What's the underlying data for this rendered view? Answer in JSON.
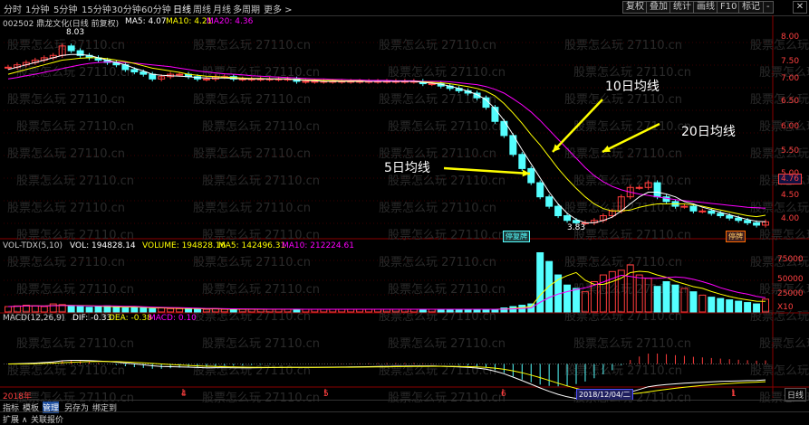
{
  "toolbar": {
    "timeframes": [
      "分时",
      "1分钟",
      "5分钟",
      "15分钟",
      "30分钟",
      "60分钟",
      "日线",
      "周线",
      "月线",
      "多周期",
      "更多 >"
    ],
    "active": "日线",
    "buttons": [
      "复权",
      "叠加",
      "统计",
      "画线",
      "F10",
      "标记",
      "-"
    ],
    "close_label": "✕"
  },
  "price_panel": {
    "title": "002502 鼎龙文化(日线 前复权)",
    "ma5_label": "MA5: 4.07",
    "ma10_label": "MA10: 4.21",
    "ma20_label": "MA20: 4.36",
    "top_value": "8.03",
    "low_value": "3.83",
    "y_ticks": [
      "8.00",
      "7.50",
      "7.00",
      "6.50",
      "6.00",
      "5.50",
      "5.00",
      "4.50",
      "4.00"
    ],
    "current_price": "4.76",
    "badge_left": "停复牌",
    "badge_right": "停牌"
  },
  "annotations": {
    "ma10": "10日均线",
    "ma20": "20日均线",
    "ma5": "5日均线"
  },
  "volume_panel": {
    "title": "VOL-TDX(5,10)",
    "vol_label": "VOL: 194828.14",
    "volume_label": "VOLUME: 194828.16",
    "ma5_label": "MA5: 142496.31",
    "ma10_label": "MA10: 212224.61",
    "y_ticks": [
      "75000",
      "50000",
      "25000"
    ],
    "unit": "X10"
  },
  "macd_panel": {
    "title": "MACD(12,26,9)",
    "dif_label": "DIF: -0.33",
    "dea_label": "DEA: -0.38",
    "macd_label": "MACD: 0.10"
  },
  "xaxis": {
    "year_label": "2018年",
    "month_marks": [
      "4",
      "5",
      "6",
      "1"
    ],
    "cursor_date": "2018/12/04/二",
    "side_label": "日线"
  },
  "bottom_tabs": [
    "指标",
    "模板",
    "管理",
    "另存为",
    "绑定到"
  ],
  "bottom_tabs_active": "管理",
  "status_bar": [
    "扩展 ∧",
    "关联报价"
  ],
  "watermark": "股票怎么玩 27110.cn",
  "colors": {
    "up": "#ff3c3c",
    "down": "#54ffff",
    "ma5": "#ffffff",
    "ma10": "#ffff00",
    "ma20": "#ff00ff",
    "text_red": "#ff4040"
  },
  "chart_data": {
    "type": "candlestick",
    "title": "002502 鼎龙文化(日线 前复权)",
    "ylim": [
      3.75,
      8.2
    ],
    "closes": [
      7.35,
      7.4,
      7.45,
      7.5,
      7.55,
      7.6,
      7.8,
      7.7,
      7.6,
      7.55,
      7.5,
      7.45,
      7.4,
      7.3,
      7.25,
      7.2,
      7.1,
      7.15,
      7.2,
      7.2,
      7.15,
      7.1,
      7.1,
      7.15,
      7.15,
      7.1,
      7.1,
      7.1,
      7.1,
      7.1,
      7.1,
      7.1,
      7.05,
      7.05,
      7.05,
      7.05,
      7.05,
      7.05,
      7.05,
      7.05,
      7.05,
      7.05,
      7.05,
      7.05,
      7.05,
      7.05,
      7.0,
      7.0,
      6.95,
      6.9,
      6.85,
      6.8,
      6.7,
      6.5,
      6.2,
      5.9,
      5.5,
      5.2,
      4.9,
      4.6,
      4.4,
      4.2,
      4.1,
      4.05,
      4.05,
      4.1,
      4.2,
      4.3,
      4.6,
      4.8,
      4.8,
      4.9,
      4.6,
      4.5,
      4.4,
      4.4,
      4.3,
      4.3,
      4.25,
      4.2,
      4.15,
      4.1,
      4.05,
      4.0,
      4.07
    ],
    "ma5": [
      7.3,
      7.35,
      7.4,
      7.45,
      7.5,
      7.55,
      7.6,
      7.62,
      7.62,
      7.6,
      7.55,
      7.5,
      7.45,
      7.4,
      7.33,
      7.27,
      7.2,
      7.18,
      7.17,
      7.16,
      7.15,
      7.13,
      7.12,
      7.12,
      7.12,
      7.11,
      7.1,
      7.1,
      7.1,
      7.1,
      7.1,
      7.1,
      7.08,
      7.07,
      7.06,
      7.05,
      7.05,
      7.05,
      7.05,
      7.05,
      7.05,
      7.05,
      7.05,
      7.05,
      7.05,
      7.05,
      7.03,
      7.01,
      6.99,
      6.95,
      6.9,
      6.84,
      6.77,
      6.66,
      6.47,
      6.22,
      5.92,
      5.6,
      5.3,
      5.0,
      4.7,
      4.45,
      4.25,
      4.12,
      4.05,
      4.05,
      4.1,
      4.17,
      4.3,
      4.45,
      4.6,
      4.7,
      4.7,
      4.66,
      4.6,
      4.5,
      4.45,
      4.38,
      4.33,
      4.27,
      4.22,
      4.17,
      4.12,
      4.08,
      4.07
    ],
    "ma10": [
      7.2,
      7.25,
      7.3,
      7.35,
      7.4,
      7.45,
      7.5,
      7.52,
      7.54,
      7.55,
      7.55,
      7.53,
      7.5,
      7.47,
      7.43,
      7.38,
      7.33,
      7.3,
      7.27,
      7.24,
      7.2,
      7.18,
      7.16,
      7.15,
      7.14,
      7.13,
      7.12,
      7.11,
      7.11,
      7.1,
      7.1,
      7.1,
      7.09,
      7.08,
      7.08,
      7.07,
      7.07,
      7.06,
      7.06,
      7.06,
      7.05,
      7.05,
      7.05,
      7.05,
      7.05,
      7.05,
      7.04,
      7.03,
      7.02,
      7.0,
      6.97,
      6.94,
      6.9,
      6.84,
      6.74,
      6.58,
      6.38,
      6.16,
      5.92,
      5.7,
      5.45,
      5.2,
      4.98,
      4.78,
      4.6,
      4.45,
      4.35,
      4.3,
      4.3,
      4.32,
      4.38,
      4.42,
      4.45,
      4.45,
      4.45,
      4.45,
      4.43,
      4.4,
      4.36,
      4.32,
      4.28,
      4.24,
      4.2,
      4.18,
      4.21
    ],
    "ma20": [
      7.1,
      7.13,
      7.17,
      7.2,
      7.24,
      7.28,
      7.32,
      7.36,
      7.4,
      7.43,
      7.45,
      7.46,
      7.46,
      7.45,
      7.44,
      7.42,
      7.4,
      7.38,
      7.36,
      7.33,
      7.3,
      7.27,
      7.25,
      7.23,
      7.21,
      7.2,
      7.19,
      7.17,
      7.16,
      7.15,
      7.14,
      7.13,
      7.12,
      7.11,
      7.1,
      7.1,
      7.09,
      7.09,
      7.08,
      7.08,
      7.07,
      7.07,
      7.07,
      7.06,
      7.06,
      7.06,
      7.05,
      7.05,
      7.05,
      7.04,
      7.02,
      7.0,
      6.98,
      6.94,
      6.88,
      6.8,
      6.68,
      6.55,
      6.4,
      6.22,
      6.02,
      5.82,
      5.62,
      5.42,
      5.22,
      5.05,
      4.92,
      4.82,
      4.75,
      4.7,
      4.66,
      4.63,
      4.6,
      4.57,
      4.54,
      4.52,
      4.5,
      4.48,
      4.46,
      4.44,
      4.42,
      4.4,
      4.38,
      4.37,
      4.36
    ],
    "volumes": [
      8,
      9,
      10,
      9,
      8,
      12,
      11,
      9,
      8,
      7,
      8,
      9,
      7,
      6,
      7,
      6,
      5,
      6,
      5,
      5,
      5,
      4,
      4,
      5,
      4,
      4,
      4,
      4,
      4,
      4,
      4,
      4,
      4,
      4,
      4,
      4,
      4,
      4,
      4,
      4,
      4,
      4,
      4,
      4,
      4,
      4,
      4,
      4,
      4,
      4,
      4,
      4,
      4,
      4,
      4,
      6,
      8,
      10,
      12,
      88,
      75,
      55,
      40,
      35,
      30,
      45,
      55,
      60,
      62,
      70,
      55,
      50,
      38,
      45,
      40,
      35,
      30,
      25,
      22,
      20,
      18,
      16,
      14,
      12,
      19
    ]
  }
}
